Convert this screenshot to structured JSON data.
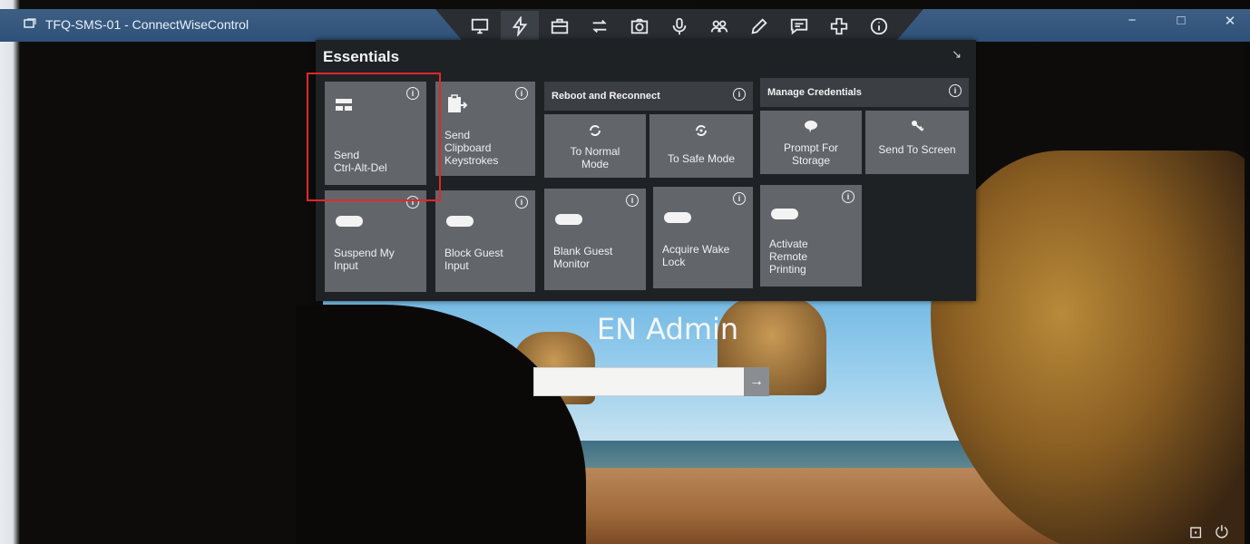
{
  "window": {
    "title": "TFQ-SMS-01 - ConnectWiseControl",
    "controls": [
      "−",
      "□",
      "✕"
    ]
  },
  "toolbar": {
    "icons": [
      "monitor-icon",
      "lightning-icon",
      "briefcase-icon",
      "swap-icon",
      "camera-icon",
      "microphone-icon",
      "participants-icon",
      "pencil-icon",
      "chat-icon",
      "plus-icon",
      "info-icon"
    ],
    "active": "lightning-icon"
  },
  "essentials": {
    "title": "Essentials",
    "tiles": {
      "send_cad": "Send\nCtrl-Alt-Del",
      "send_clipboard": "Send\nClipboard\nKeystrokes",
      "suspend_input": "Suspend My\nInput",
      "block_guest": "Block Guest\nInput",
      "blank_monitor": "Blank Guest\nMonitor",
      "wake_lock": "Acquire Wake\nLock",
      "remote_printing": "Activate\nRemote\nPrinting"
    },
    "reboot_group": {
      "header": "Reboot and Reconnect",
      "normal": "To Normal\nMode",
      "safe": "To Safe Mode"
    },
    "credentials_group": {
      "header": "Manage Credentials",
      "prompt": "Prompt For\nStorage",
      "send": "Send To Screen"
    },
    "info_glyph": "i"
  },
  "login": {
    "username": "EN Admin",
    "submit_glyph": "→"
  },
  "colors": {
    "panel_bg": "#1f2225",
    "tile_bg": "#62666b",
    "highlight": "#e0282a",
    "titlebar": "#2f5179"
  }
}
